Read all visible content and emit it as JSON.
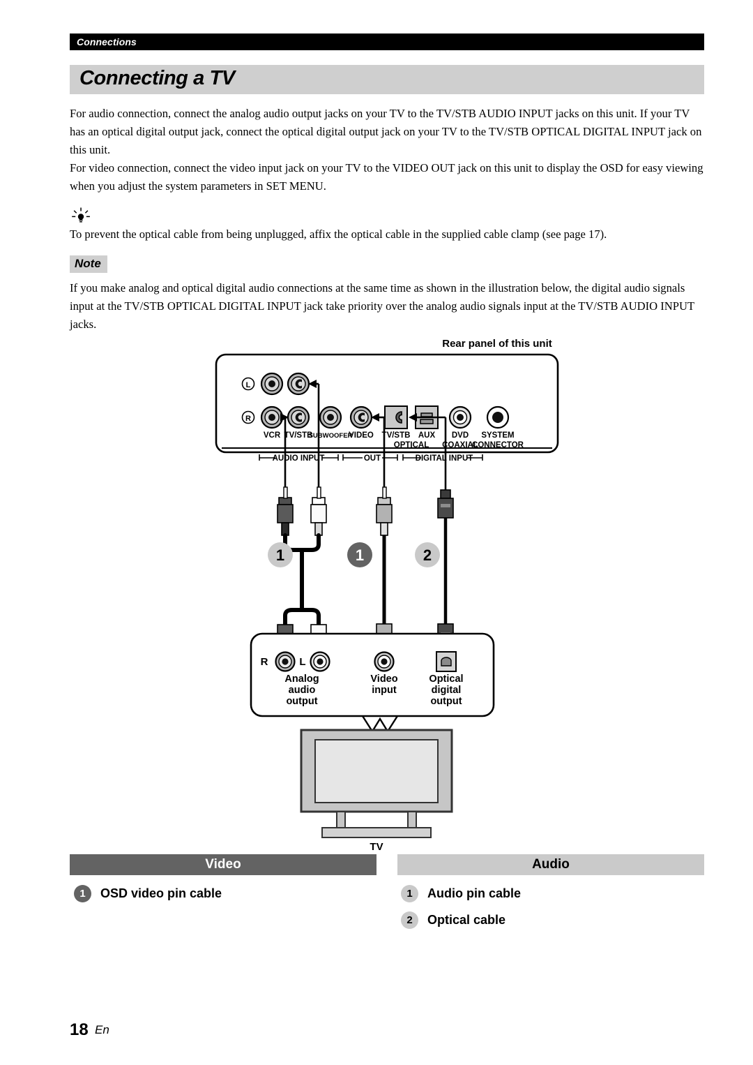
{
  "running_head": "Connections",
  "section_title": "Connecting a TV",
  "paragraphs": {
    "audio": "For audio connection, connect the analog audio output jacks on your TV to the TV/STB AUDIO INPUT jacks on this unit. If your TV has an optical digital output jack, connect the optical digital output jack on your TV to the TV/STB OPTICAL DIGITAL INPUT jack on this unit.",
    "video": "For video connection, connect the video input jack on your TV to the VIDEO OUT jack on this unit to display the OSD for easy viewing when you adjust the system parameters in SET MENU.",
    "tip": "To prevent the optical cable from being unplugged, affix the optical cable in the supplied cable clamp (see page 17).",
    "note_label": "Note",
    "note": "If you make analog and optical digital audio connections at the same time as shown in the illustration below, the digital audio signals input at the TV/STB OPTICAL DIGITAL INPUT jack take priority over the analog audio signals input at the TV/STB AUDIO INPUT jacks."
  },
  "diagram": {
    "rear_panel_caption": "Rear panel of this unit",
    "rear_panel": {
      "channel_labels": {
        "left": "L",
        "right": "R"
      },
      "jacks": [
        {
          "name": "VCR",
          "label": "VCR"
        },
        {
          "name": "TV/STB",
          "label": "TV/STB"
        },
        {
          "name": "SUBWOOFER",
          "label": "SUBWOOFER"
        },
        {
          "name": "VIDEO",
          "label": "VIDEO"
        },
        {
          "name": "TV/STB OPTICAL",
          "label": "TV/STB",
          "sub": "OPTICAL"
        },
        {
          "name": "AUX",
          "label": "AUX"
        },
        {
          "name": "DVD COAXIAL",
          "label": "DVD",
          "sub": "COAXIAL"
        },
        {
          "name": "SYSTEM CONNECTOR",
          "label": "SYSTEM",
          "sub": "CONNECTOR"
        }
      ],
      "groups": [
        {
          "label": "AUDIO INPUT"
        },
        {
          "label": "OUT"
        },
        {
          "label": "DIGITAL INPUT"
        }
      ]
    },
    "cable_badges": [
      {
        "number": "1",
        "style": "light"
      },
      {
        "number": "1",
        "style": "dark"
      },
      {
        "number": "2",
        "style": "light"
      }
    ],
    "tv_panel": {
      "channel_r": "R",
      "channel_l": "L",
      "ports": [
        {
          "label": "Analog\naudio\noutput",
          "lines": [
            "Analog",
            "audio",
            "output"
          ]
        },
        {
          "label": "Video\ninput",
          "lines": [
            "Video",
            "input"
          ]
        },
        {
          "label": "Optical\ndigital\noutput",
          "lines": [
            "Optical",
            "digital",
            "output"
          ]
        }
      ]
    },
    "tv_caption": "TV"
  },
  "legend": {
    "video": {
      "title": "Video",
      "items": [
        {
          "badge": "1",
          "style": "dark",
          "label": "OSD video pin cable"
        }
      ]
    },
    "audio": {
      "title": "Audio",
      "items": [
        {
          "badge": "1",
          "style": "light",
          "label": "Audio pin cable"
        },
        {
          "badge": "2",
          "style": "light",
          "label": "Optical cable"
        }
      ]
    }
  },
  "footer": {
    "page_number": "18",
    "language": "En"
  },
  "colors": {
    "header_bar": "#000000",
    "title_bar": "#cfcfcf",
    "legend_video_bar": "#636363",
    "legend_audio_bar": "#cacaca",
    "badge_dark": "#636363",
    "badge_light": "#c9c9c9"
  }
}
